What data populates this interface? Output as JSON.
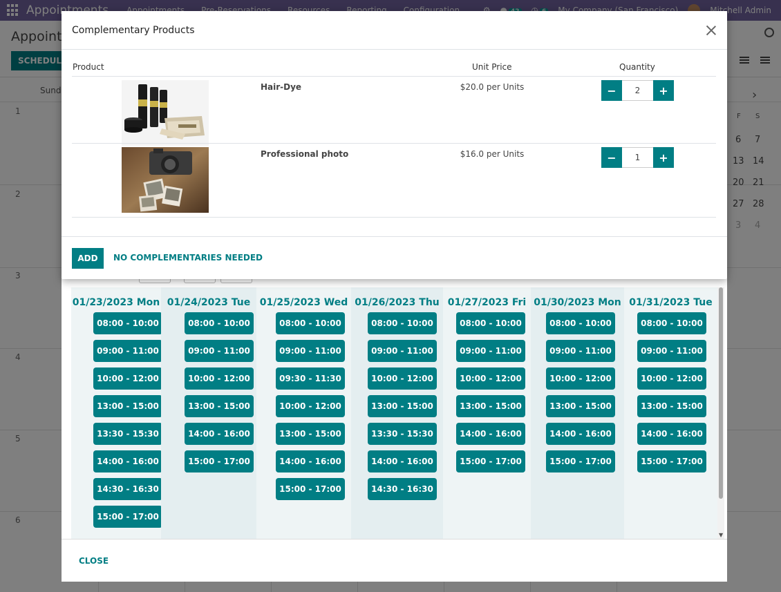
{
  "app": {
    "brand": "Appointments",
    "menu": [
      "Appointments",
      "Pre-Reservations",
      "Resources",
      "Reporting",
      "Configuration"
    ],
    "messages_count": "42",
    "activities_count": "6",
    "company": "My Company (San Francisco)",
    "user": "Mitchell Admin"
  },
  "control_panel": {
    "breadcrumb": "Appointm",
    "schedule_label": "SCHEDULE"
  },
  "calendar": {
    "first_day_header": "Sund",
    "week_numbers": [
      "1",
      "2",
      "3",
      "4",
      "5",
      "6"
    ],
    "mini": {
      "weekday_headers": [
        "F",
        "S"
      ],
      "days": [
        [
          "6",
          "7"
        ],
        [
          "13",
          "14"
        ],
        [
          "20",
          "21"
        ],
        [
          "27",
          "28"
        ],
        [
          "3",
          "4"
        ]
      ]
    }
  },
  "slots_dialog": {
    "days": [
      {
        "label": "01/23/2023 Mon",
        "slots": [
          "08:00 - 10:00",
          "09:00 - 11:00",
          "10:00 - 12:00",
          "13:00 - 15:00",
          "13:30 - 15:30",
          "14:00 - 16:00",
          "14:30 - 16:30",
          "15:00 - 17:00"
        ]
      },
      {
        "label": "01/24/2023 Tue",
        "slots": [
          "08:00 - 10:00",
          "09:00 - 11:00",
          "10:00 - 12:00",
          "13:00 - 15:00",
          "14:00 - 16:00",
          "15:00 - 17:00"
        ]
      },
      {
        "label": "01/25/2023 Wed",
        "slots": [
          "08:00 - 10:00",
          "09:00 - 11:00",
          "09:30 - 11:30",
          "10:00 - 12:00",
          "13:00 - 15:00",
          "14:00 - 16:00",
          "15:00 - 17:00"
        ]
      },
      {
        "label": "01/26/2023 Thu",
        "slots": [
          "08:00 - 10:00",
          "09:00 - 11:00",
          "10:00 - 12:00",
          "13:00 - 15:00",
          "13:30 - 15:30",
          "14:00 - 16:00",
          "14:30 - 16:30"
        ]
      },
      {
        "label": "01/27/2023 Fri",
        "slots": [
          "08:00 - 10:00",
          "09:00 - 11:00",
          "10:00 - 12:00",
          "13:00 - 15:00",
          "14:00 - 16:00",
          "15:00 - 17:00"
        ]
      },
      {
        "label": "01/30/2023 Mon",
        "slots": [
          "08:00 - 10:00",
          "09:00 - 11:00",
          "10:00 - 12:00",
          "13:00 - 15:00",
          "14:00 - 16:00",
          "15:00 - 17:00"
        ]
      },
      {
        "label": "01/31/2023 Tue",
        "slots": [
          "08:00 - 10:00",
          "09:00 - 11:00",
          "10:00 - 12:00",
          "13:00 - 15:00",
          "14:00 - 16:00",
          "15:00 - 17:00"
        ]
      }
    ],
    "close_label": "CLOSE"
  },
  "modal": {
    "title": "Complementary Products",
    "columns": {
      "product": "Product",
      "unit_price": "Unit Price",
      "quantity": "Quantity"
    },
    "rows": [
      {
        "name": "Hair-Dye",
        "price": "$20.0 per Units",
        "quantity": "2"
      },
      {
        "name": "Professional photo",
        "price": "$16.0 per Units",
        "quantity": "1"
      }
    ],
    "add_label": "ADD",
    "no_label": "NO COMPLEMENTARIES NEEDED"
  },
  "colors": {
    "primary": "#017e84",
    "navbar": "#71639e"
  }
}
